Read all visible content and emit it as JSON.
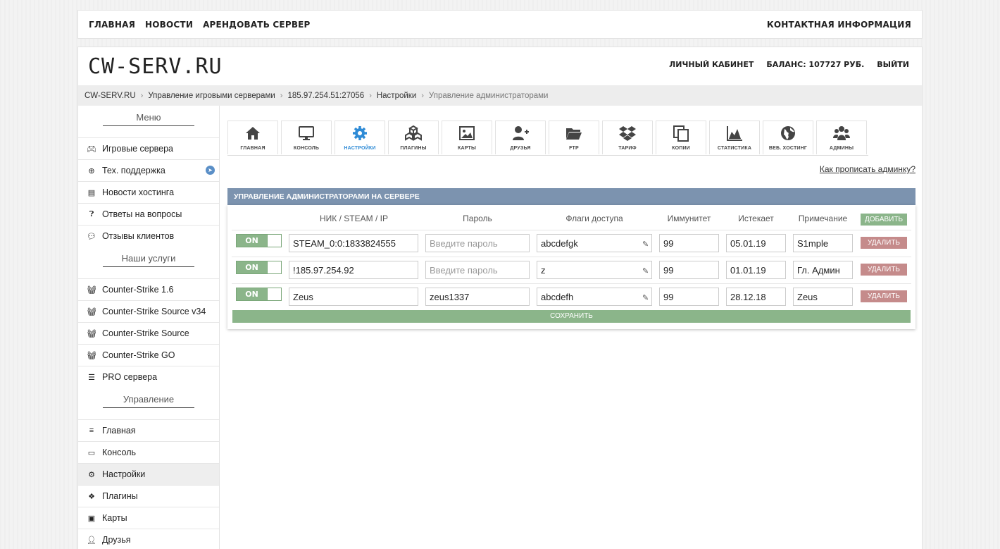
{
  "topnav": {
    "items": [
      "ГЛАВНАЯ",
      "НОВОСТИ",
      "АРЕНДОВАТЬ СЕРВЕР"
    ],
    "contact": "КОНТАКТНАЯ ИНФОРМАЦИЯ"
  },
  "header": {
    "logo": "CW-SERV.RU",
    "account": "ЛИЧНЫЙ КАБИНЕТ",
    "balance": "БАЛАНС: 107727 РУБ.",
    "logout": "ВЫЙТИ"
  },
  "breadcrumb": {
    "items": [
      "CW-SERV.RU",
      "Управление игровыми серверами",
      "185.97.254.51:27056",
      "Настройки"
    ],
    "current": "Управление администраторами",
    "separator": "›"
  },
  "sidebar": {
    "menu_title": "Меню",
    "menu": [
      {
        "label": "Игровые сервера",
        "icon": "gamepad-icon"
      },
      {
        "label": "Тех. поддержка",
        "icon": "lifebuoy-icon"
      },
      {
        "label": "Новости хостинга",
        "icon": "newspaper-icon"
      },
      {
        "label": "Ответы на вопросы",
        "icon": "question-icon"
      },
      {
        "label": "Отзывы клиентов",
        "icon": "comments-icon"
      }
    ],
    "services_title": "Наши услуги",
    "services": [
      {
        "label": "Counter-Strike 1.6",
        "icon": "basket-icon"
      },
      {
        "label": "Counter-Strike Source v34",
        "icon": "basket-icon"
      },
      {
        "label": "Counter-Strike Source",
        "icon": "basket-icon"
      },
      {
        "label": "Counter-Strike GO",
        "icon": "basket-icon"
      },
      {
        "label": "PRO сервера",
        "icon": "server-icon"
      }
    ],
    "manage_title": "Управление",
    "manage": [
      {
        "label": "Главная",
        "icon": "bars-icon"
      },
      {
        "label": "Консоль",
        "icon": "monitor-icon"
      },
      {
        "label": "Настройки",
        "icon": "gear-icon"
      },
      {
        "label": "Плагины",
        "icon": "cubes-icon"
      },
      {
        "label": "Карты",
        "icon": "image-icon"
      },
      {
        "label": "Друзья",
        "icon": "user-plus-icon"
      }
    ]
  },
  "tabs": [
    {
      "label": "ГЛАВНАЯ",
      "icon": "home-icon"
    },
    {
      "label": "КОНСОЛЬ",
      "icon": "monitor-icon"
    },
    {
      "label": "НАСТРОЙКИ",
      "icon": "gear-icon"
    },
    {
      "label": "ПЛАГИНЫ",
      "icon": "cubes-icon"
    },
    {
      "label": "КАРТЫ",
      "icon": "image-icon"
    },
    {
      "label": "ДРУЗЬЯ",
      "icon": "user-plus-icon"
    },
    {
      "label": "FTP",
      "icon": "folder-icon"
    },
    {
      "label": "ТАРИФ",
      "icon": "dropbox-icon"
    },
    {
      "label": "КОПИИ",
      "icon": "copy-icon"
    },
    {
      "label": "СТАТИСТИКА",
      "icon": "area-chart-icon"
    },
    {
      "label": "ВЕБ. ХОСТИНГ",
      "icon": "globe-icon"
    },
    {
      "label": "АДМИНЫ",
      "icon": "users-icon"
    }
  ],
  "active_tab": "НАСТРОЙКИ",
  "help_link": "Как прописать админку?",
  "admins": {
    "title": "УПРАВЛЕНИЕ АДМИНИСТРАТОРАМИ НА СЕРВЕРЕ",
    "columns": {
      "nick": "НИК / STEAM / IP",
      "password": "Пароль",
      "flags": "Флаги доступа",
      "immunity": "Иммунитет",
      "expires": "Истекает",
      "note": "Примечание"
    },
    "add_label": "ДОБАВИТЬ",
    "delete_label": "УДАЛИТЬ",
    "save_label": "СОХРАНИТЬ",
    "toggle_label": "ON",
    "password_placeholder": "Введите пароль",
    "rows": [
      {
        "nick": "STEAM_0:0:1833824555",
        "password": "",
        "flags": "abcdefgk",
        "immunity": "99",
        "expires": "05.01.19",
        "note": "S1mple"
      },
      {
        "nick": "!185.97.254.92",
        "password": "",
        "flags": "z",
        "immunity": "99",
        "expires": "01.01.19",
        "note": "Гл. Админ"
      },
      {
        "nick": "Zeus",
        "password": "zeus1337",
        "flags": "abcdefh",
        "immunity": "99",
        "expires": "28.12.18",
        "note": "Zeus"
      }
    ]
  },
  "colors": {
    "panel_header": "#7c93af",
    "green_button": "#8bb58a",
    "red_button": "#c58b8b",
    "active_tab_icon": "#2f8bd6"
  }
}
